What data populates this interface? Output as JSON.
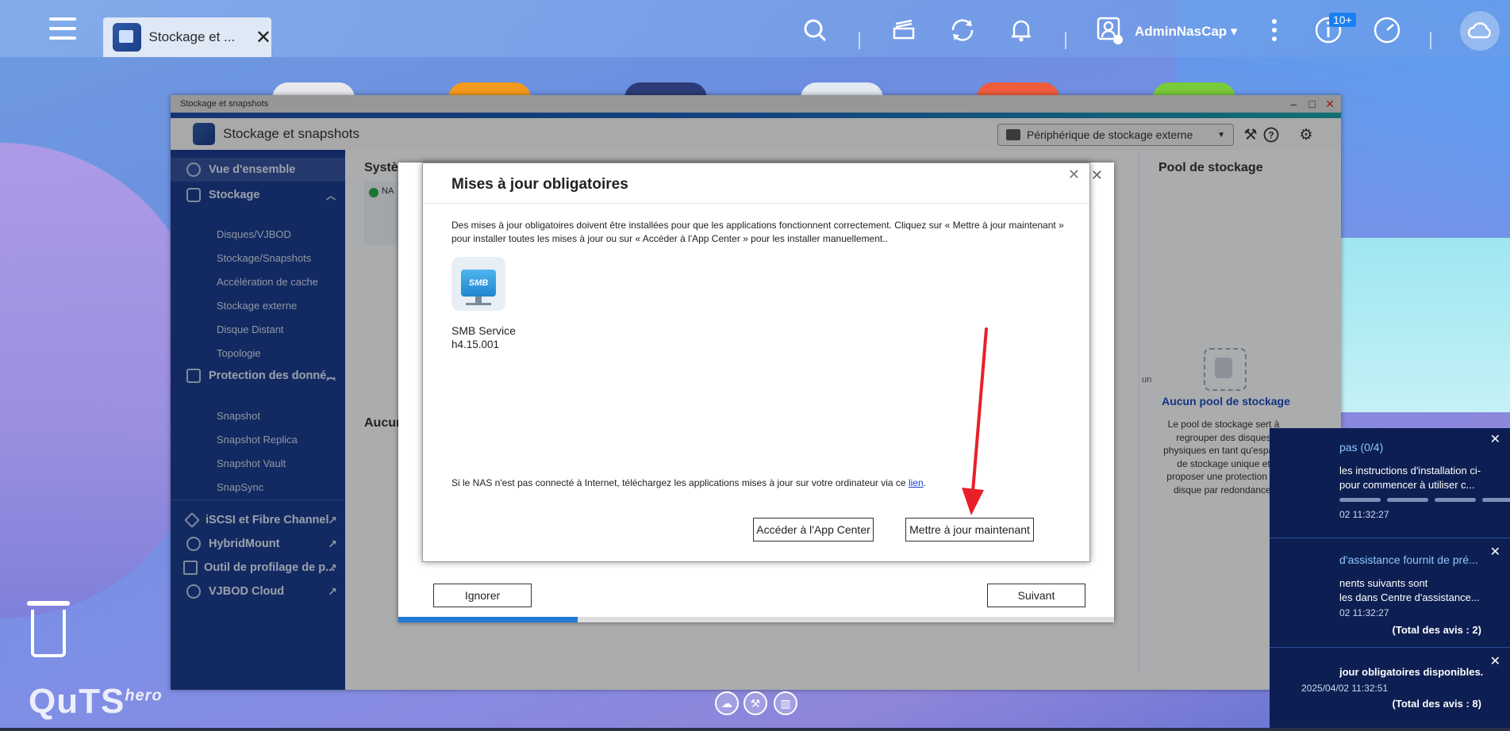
{
  "taskbar": {
    "app_tab_label": "Stockage et ...",
    "user_name": "AdminNasCap",
    "user_caret": "▾",
    "notification_badge": "10+",
    "icons": [
      "menu-icon",
      "search-icon",
      "task-icon",
      "sync-icon",
      "bell-icon",
      "user-icon",
      "more-icon",
      "info-icon",
      "dashboard-icon",
      "cloud-icon"
    ]
  },
  "window": {
    "titlebar": "Stockage et snapshots",
    "header_title": "Stockage et snapshots",
    "external_device": "Périphérique de stockage externe",
    "controls": {
      "minimize": "–",
      "maximize": "□",
      "close": "✕"
    }
  },
  "sidebar": {
    "overview": "Vue d'ensemble",
    "storage": "Stockage",
    "storage_items": [
      "Disques/VJBOD",
      "Stockage/Snapshots",
      "Accélération de cache",
      "Stockage externe",
      "Disque Distant",
      "Topologie"
    ],
    "protection": "Protection des donné...",
    "protection_items": [
      "Snapshot",
      "Snapshot Replica",
      "Snapshot Vault",
      "SnapSync"
    ],
    "iscsi": "iSCSI et Fibre Channel",
    "hybridmount": "HybridMount",
    "profiling": "Outil de profilage de p...",
    "vjbod_cloud": "VJBOD Cloud"
  },
  "content": {
    "system_title": "Systè",
    "system_status_short": "NA",
    "none_title": "Aucur",
    "right_clip": "un",
    "pool_title": "Pool de stockage",
    "pool_empty_link": "Aucun pool de stockage",
    "pool_desc": "Le pool de stockage sert à regrouper des disques physiques en tant qu'espace de stockage unique et proposer une protection de disque par redondance."
  },
  "wizard": {
    "ignore_label": "Ignorer",
    "next_label": "Suivant",
    "progress_fraction": 0.25,
    "close": "✕"
  },
  "updates_dialog": {
    "title": "Mises à jour obligatoires",
    "close": "✕",
    "description": "Des mises à jour obligatoires doivent être installées pour que les applications fonctionnent correctement. Cliquez sur « Mettre à jour maintenant » pour installer toutes les mises à jour ou sur « Accéder à l'App Center » pour les installer manuellement..",
    "app": {
      "icon_text": "SMB",
      "name": "SMB Service",
      "version": "h4.15.001"
    },
    "note_prefix": "Si le NAS n'est pas connecté à Internet, téléchargez les applications mises à jour sur votre ordinateur via ce ",
    "note_link": "lien",
    "note_suffix": ".",
    "app_center_label": "Accéder à l'App Center",
    "update_now_label": "Mettre à jour maintenant"
  },
  "notifications": [
    {
      "title": "pas (0/4)",
      "body1": "les instructions d'installation ci-",
      "body2": "pour commencer à utiliser c...",
      "time": "02 11:32:27",
      "progress_steps": 4
    },
    {
      "title": "d'assistance fournit de pré...",
      "body1": "nents suivants sont",
      "body2": "les dans Centre d'assistance...",
      "time": "02 11:32:27",
      "total": "(Total des avis : 2)"
    },
    {
      "body1": "jour obligatoires disponibles.",
      "time": "2025/04/02 11:32:51",
      "total": "(Total des avis : 8)"
    }
  ],
  "desktop": {
    "brand": "QuTS",
    "brand_sup": "hero"
  },
  "colors": {
    "sidebar_bg": "#1b3d8c",
    "accent_blue": "#1f7ad6",
    "link_blue": "#1e4db8",
    "arrow_red": "#e8202a",
    "notification_bg": "#0d1f52"
  }
}
